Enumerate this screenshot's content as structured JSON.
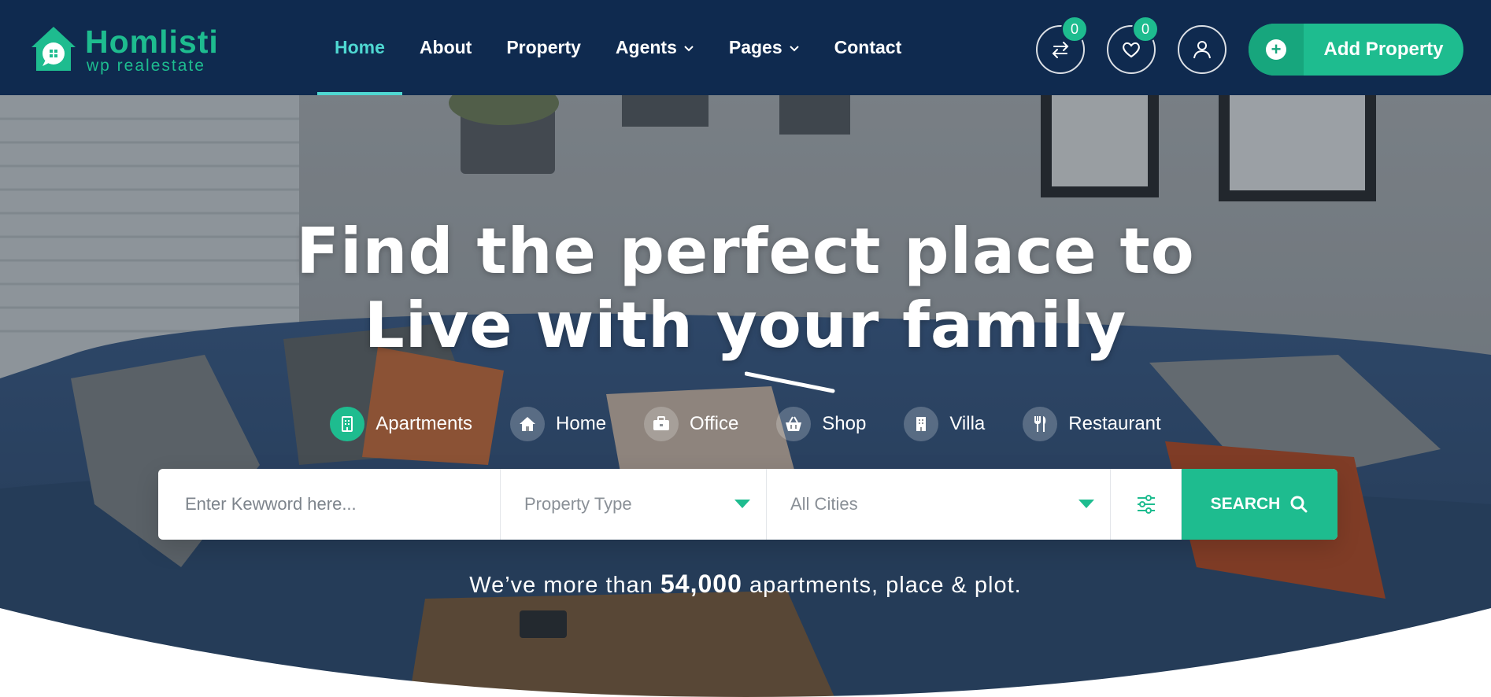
{
  "brand": {
    "name": "Homlisti",
    "tagline": "wp realestate",
    "accent": "#1ebc8f",
    "header_bg": "#0f2a4f",
    "active_nav": "#4fd8d2"
  },
  "nav": {
    "items": [
      {
        "label": "Home",
        "active": true
      },
      {
        "label": "About"
      },
      {
        "label": "Property"
      },
      {
        "label": "Agents",
        "dropdown": true
      },
      {
        "label": "Pages",
        "dropdown": true
      },
      {
        "label": "Contact"
      }
    ]
  },
  "header_actions": {
    "compare_count": "0",
    "wishlist_count": "0",
    "compare_icon": "compare-arrows-icon",
    "wishlist_icon": "heart-icon",
    "user_icon": "user-icon",
    "add_property_label": "Add Property"
  },
  "hero": {
    "headline_line1": "Find the perfect place to",
    "headline_line2": "Live with your family",
    "categories": [
      {
        "label": "Apartments",
        "icon": "building-icon",
        "active": true
      },
      {
        "label": "Home",
        "icon": "house-icon"
      },
      {
        "label": "Office",
        "icon": "briefcase-icon"
      },
      {
        "label": "Shop",
        "icon": "basket-icon"
      },
      {
        "label": "Villa",
        "icon": "villa-icon"
      },
      {
        "label": "Restaurant",
        "icon": "cutlery-icon"
      }
    ]
  },
  "search": {
    "keyword_placeholder": "Enter Kewword here...",
    "property_type": "Property Type",
    "cities": "All Cities",
    "button_label": "SEARCH"
  },
  "stat": {
    "prefix": "We’ve more than",
    "number": "54,000",
    "suffix": "apartments, place & plot."
  }
}
